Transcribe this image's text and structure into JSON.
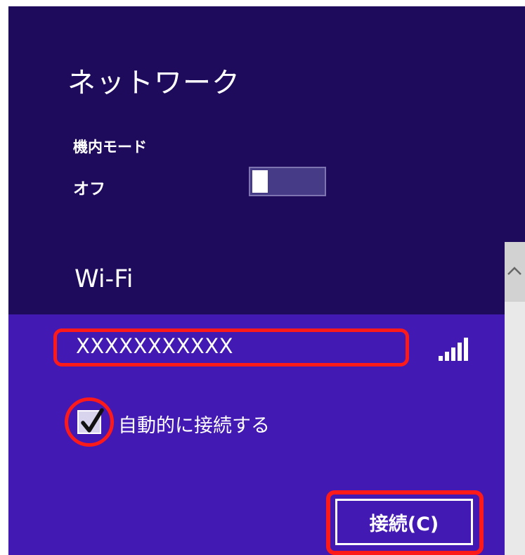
{
  "header": {
    "title": "ネットワーク"
  },
  "airplane_mode": {
    "label": "機内モード",
    "state": "オフ",
    "enabled": false
  },
  "wifi": {
    "heading": "Wi-Fi",
    "network": {
      "ssid": "XXXXXXXXXXX",
      "signal_icon": "signal-bars-icon",
      "signal_bars": 5,
      "auto_connect_label": "自動的に接続する",
      "auto_connect_checked": true,
      "connect_button_label": "接続(C)"
    }
  },
  "scrollbar": {
    "up_icon": "chevron-up-icon"
  },
  "colors": {
    "panel_bg": "#1e0b5c",
    "network_item_bg": "#4319b4",
    "highlight": "#ff1a1a",
    "text": "#ffffff"
  }
}
